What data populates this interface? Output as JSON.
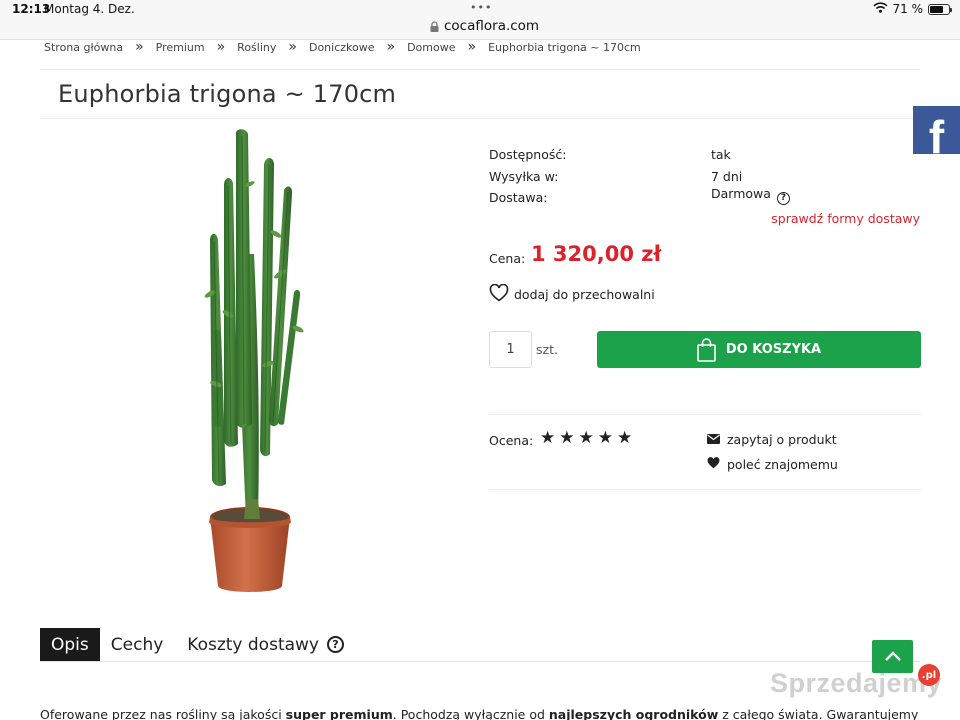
{
  "status_bar": {
    "time": "12:13",
    "date": "Montag 4. Dez.",
    "url": "cocaflora.com",
    "battery": "71 %",
    "battery_level": 0.71
  },
  "breadcrumb": {
    "separator": "»",
    "items": [
      "Strona główna",
      "Premium",
      "Rośliny",
      "Doniczkowe",
      "Domowe",
      "Euphorbia trigona ~ 170cm"
    ]
  },
  "product": {
    "title": "Euphorbia trigona ~ 170cm",
    "details": {
      "availability_label": "Dostępność:",
      "availability_value": "tak",
      "shipping_label": "Wysyłka w:",
      "shipping_value": "7 dni",
      "delivery_label": "Dostawa:",
      "delivery_value": "Darmowa",
      "check_delivery": "sprawdź formy dostawy"
    },
    "price_label": "Cena:",
    "price": "1 320,00 zł",
    "wishlist": "dodaj do przechowalni",
    "quantity_value": "1",
    "quantity_unit": "szt.",
    "add_to_cart": "DO KOSZYKA",
    "rating_label": "Ocena:",
    "rating_value": 5,
    "rating_max": 5,
    "ask_link": "zapytaj o produkt",
    "recommend_link": "poleć znajomemu"
  },
  "social": {
    "facebook_glyph": "f"
  },
  "tabs": [
    "Opis",
    "Cechy",
    "Koszty dostawy"
  ],
  "description": {
    "part1": "Oferowane przez nas rośliny są jakości ",
    "bold1": "super premium",
    "part2": ". Pochodzą wyłącznie od ",
    "bold2": "najlepszych ogrodników",
    "part3": " z całego świata. Gwarantujemy najwyższą klasę"
  },
  "watermark": {
    "text": "Sprzedajemy",
    "badge": ".pl"
  },
  "colors": {
    "accent_red": "#d9232d",
    "cart_green": "#1ba24a",
    "facebook_blue": "#3b5998"
  }
}
